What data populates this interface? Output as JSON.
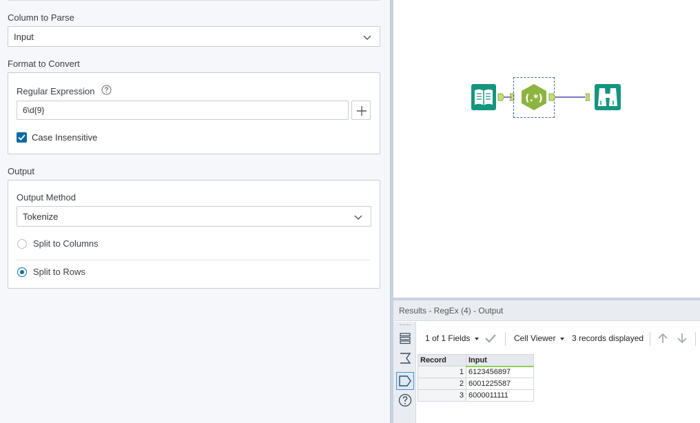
{
  "config": {
    "column_to_parse": {
      "label": "Column to Parse",
      "value": "Input"
    },
    "format_to_convert": {
      "label": "Format to Convert",
      "regex_label": "Regular Expression",
      "regex_value": "6\\d{9}",
      "case_insensitive_label": "Case Insensitive",
      "case_insensitive_checked": true
    },
    "output": {
      "label": "Output",
      "method_label": "Output Method",
      "method_value": "Tokenize",
      "options": [
        {
          "label": "Split to Columns",
          "selected": false
        },
        {
          "label": "Split to Rows",
          "selected": true
        }
      ]
    }
  },
  "canvas": {
    "tools": [
      "input-data-tool",
      "regex-tool",
      "browse-tool"
    ],
    "regex_tool_glyph": "(.*)"
  },
  "results": {
    "title": "Results - RegEx (4) - Output",
    "fields_selector": "1 of 1 Fields",
    "viewer": "Cell Viewer",
    "records_displayed": "3 records displayed",
    "columns": [
      "Record",
      "Input"
    ],
    "rows": [
      {
        "record": "1",
        "input": "6123456897"
      },
      {
        "record": "2",
        "input": "6001225587"
      },
      {
        "record": "3",
        "input": "6000011111"
      }
    ]
  },
  "colors": {
    "accent": "#0d6aa8",
    "tool_teal": "#15957f",
    "tool_green": "#8db43f",
    "connection": "#4a4aa8"
  }
}
